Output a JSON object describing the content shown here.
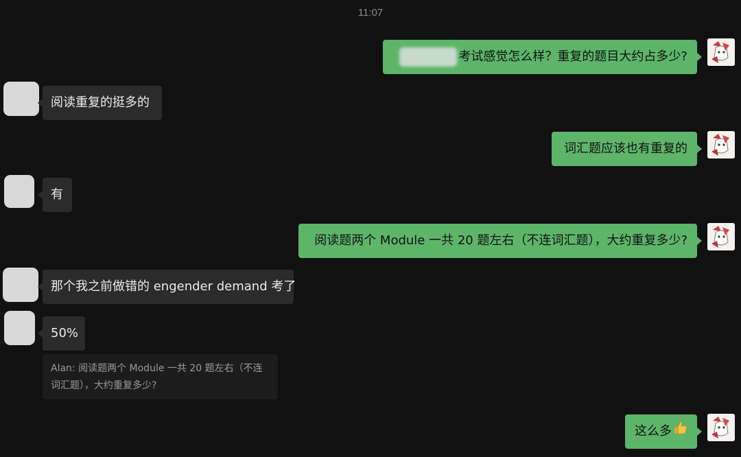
{
  "chat": {
    "timestamp": "11:07",
    "messages": [
      {
        "from": "me",
        "text": "考试感觉怎么样？重复的题目大约占多少?"
      },
      {
        "from": "them",
        "text": "阅读重复的挺多的"
      },
      {
        "from": "me",
        "text": "词汇题应该也有重复的"
      },
      {
        "from": "them",
        "text": "有"
      },
      {
        "from": "me",
        "text": "阅读题两个 Module 一共 20 题左右（不连词汇题），大约重复多少?"
      },
      {
        "from": "them",
        "text": "那个我之前做错的 engender demand 考了"
      },
      {
        "from": "them",
        "text": "50%"
      },
      {
        "from": "me",
        "text": "这么多",
        "emoji": "thumbs-up"
      }
    ],
    "quote": {
      "text": "Alan: 阅读题两个 Module 一共 20 题左右（不连词汇题），大约重复多少?"
    }
  },
  "colors": {
    "background": "#111111",
    "outgoing_bubble": "#5db56a",
    "incoming_bubble": "#2b2b2b",
    "timestamp": "#8b8b8b"
  }
}
